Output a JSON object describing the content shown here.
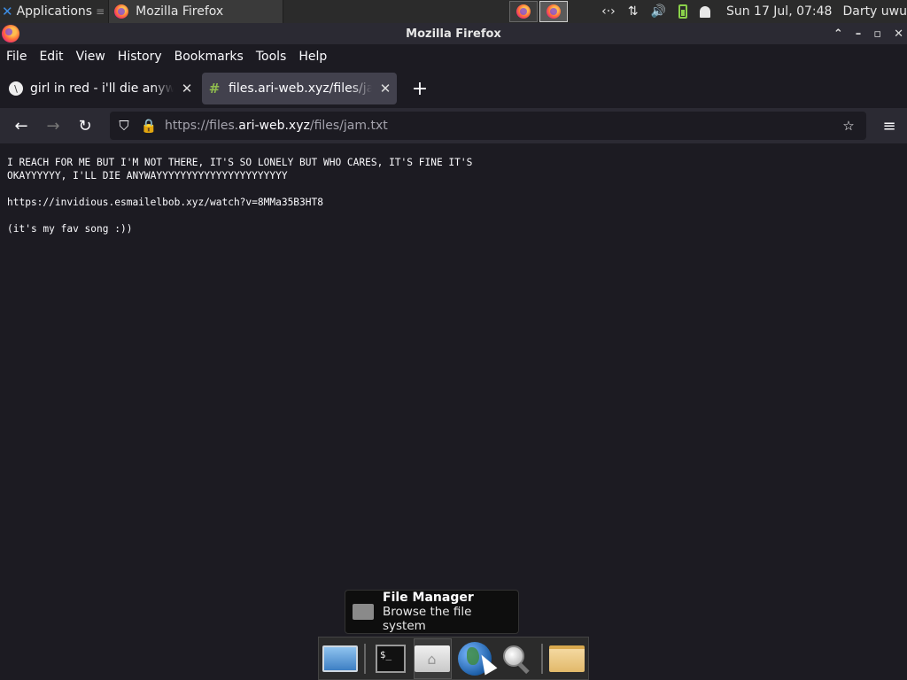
{
  "panel": {
    "apps_label": "Applications",
    "apps_icon": "xfce-icon",
    "task_label": "Mozilla Firefox",
    "tray": {
      "network_icon": "‹·›",
      "updown_icon": "⇅",
      "volume_icon": "🔊"
    },
    "clock": "Sun 17 Jul, 07:48",
    "user": "Darty uwu"
  },
  "window": {
    "title": "Mozilla Firefox",
    "controls": [
      "⌃",
      "–",
      "▫",
      "✕"
    ]
  },
  "menubar": {
    "file": "File",
    "edit": "Edit",
    "view": "View",
    "history": "History",
    "bookmarks": "Bookmarks",
    "tools": "Tools",
    "help": "Help"
  },
  "tabs": [
    {
      "label": "girl in red - i'll die anyway",
      "favicon": "invidious-icon",
      "selected": false
    },
    {
      "label": "files.ari-web.xyz/files/jam.txt",
      "favicon": "hash-icon",
      "selected": true
    }
  ],
  "navbar": {
    "url_prefix": "https://files.",
    "url_domain": "ari-web.xyz",
    "url_path": "/files/jam.txt"
  },
  "content": {
    "text": "I REACH FOR ME BUT I'M NOT THERE, IT'S SO LONELY BUT WHO CARES, IT'S FINE IT'S\nOKAYYYYYY, I'LL DIE ANYWAYYYYYYYYYYYYYYYYYYYYYY\n\nhttps://invidious.esmailelbob.xyz/watch?v=8MMa35B3HT8\n\n(it's my fav song :))"
  },
  "tooltip": {
    "title": "File Manager",
    "subtitle": "Browse the file system"
  },
  "dock": {
    "items": [
      "show-desktop",
      "terminal",
      "file-manager",
      "web-browser",
      "app-finder",
      "folder"
    ]
  }
}
